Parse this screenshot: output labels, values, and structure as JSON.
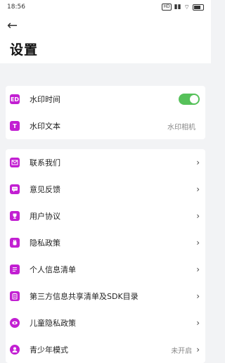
{
  "status": {
    "time": "18:56",
    "hd": "HD",
    "battery_level": 0.8
  },
  "header": {
    "back_icon": "←",
    "title": "设置"
  },
  "watermark": {
    "time_label": "水印时间",
    "time_icon": "ED",
    "toggle_on": true,
    "text_label": "水印文本",
    "text_icon": "T",
    "text_value": "水印相机"
  },
  "menu": {
    "items": [
      {
        "label": "联系我们",
        "icon": "mail-icon"
      },
      {
        "label": "意见反馈",
        "icon": "chat-icon"
      },
      {
        "label": "用户协议",
        "icon": "trophy-icon"
      },
      {
        "label": "隐私政策",
        "icon": "hand-icon"
      },
      {
        "label": "个人信息清单",
        "icon": "list-icon"
      },
      {
        "label": "第三方信息共享清单及SDK目录",
        "icon": "clipboard-icon"
      },
      {
        "label": "儿童隐私政策",
        "icon": "eye-icon"
      },
      {
        "label": "青少年模式",
        "icon": "person-icon",
        "value": "未开启"
      }
    ],
    "chevron": "›"
  },
  "colors": {
    "accent": "#c21fd2",
    "toggle": "#56c15a",
    "bg": "#f2f3f5"
  }
}
